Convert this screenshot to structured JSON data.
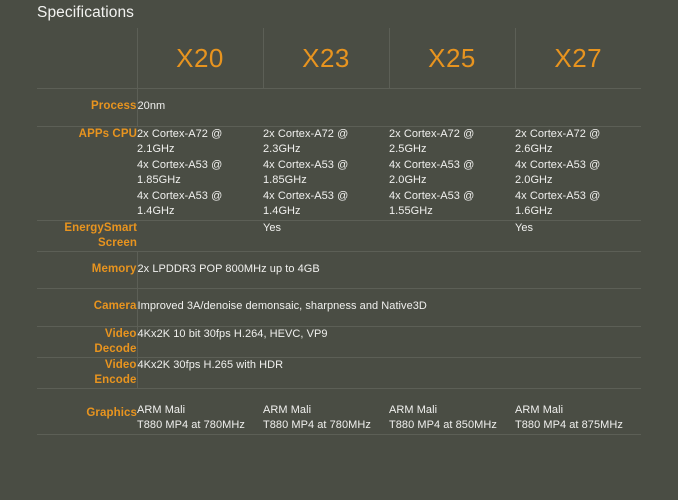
{
  "page": {
    "title": "Specifications",
    "background_color": "#4a4d44",
    "accent_color": "#e8941f",
    "text_color": "#f0f0ee",
    "grid_line_color": "#5c5f56"
  },
  "table": {
    "corner_label": "",
    "devices": [
      {
        "name": "X20"
      },
      {
        "name": "X23"
      },
      {
        "name": "X25"
      },
      {
        "name": "X27"
      }
    ],
    "rows": [
      {
        "id": "process",
        "label": "Process",
        "merged": true,
        "merged_value": [
          "20nm"
        ]
      },
      {
        "id": "apps-cpu",
        "label": "APPs CPU",
        "merged": false,
        "cells": [
          [
            "2x Cortex-A72 @",
            "2.1GHz",
            "4x Cortex-A53 @",
            "1.85GHz",
            "4x Cortex-A53 @",
            "1.4GHz"
          ],
          [
            "2x Cortex-A72 @",
            "2.3GHz",
            "4x Cortex-A53 @",
            "1.85GHz",
            "4x Cortex-A53 @",
            "1.4GHz"
          ],
          [
            "2x Cortex-A72 @",
            "2.5GHz",
            "4x Cortex-A53 @",
            "2.0GHz",
            "4x Cortex-A53 @",
            "1.55GHz"
          ],
          [
            "2x Cortex-A72 @",
            "2.6GHz",
            "4x Cortex-A53 @",
            "2.0GHz",
            "4x Cortex-A53 @",
            "1.6GHz"
          ]
        ]
      },
      {
        "id": "energysmart-screen",
        "label": "EnergySmart Screen",
        "label_lines": [
          "EnergySmart",
          "Screen"
        ],
        "merged": false,
        "cells": [
          [
            ""
          ],
          [
            "Yes"
          ],
          [
            ""
          ],
          [
            "Yes"
          ]
        ]
      },
      {
        "id": "memory",
        "label": "Memory",
        "merged": true,
        "merged_value": [
          "2x LPDDR3 POP 800MHz up to 4GB"
        ]
      },
      {
        "id": "camera",
        "label": "Camera",
        "merged": true,
        "merged_value": [
          "Improved 3A/denoise demonsaic, sharpness and Native3D"
        ]
      },
      {
        "id": "video-decode",
        "label": "Video Decode",
        "label_lines": [
          "Video",
          "Decode"
        ],
        "merged": true,
        "merged_value": [
          "4Kx2K 10 bit 30fps H.264, HEVC, VP9"
        ]
      },
      {
        "id": "video-encode",
        "label": "Video Encode",
        "label_lines": [
          "Video",
          "Encode"
        ],
        "merged": true,
        "merged_value": [
          "4Kx2K 30fps H.265 with HDR"
        ]
      },
      {
        "id": "graphics",
        "label": "Graphics",
        "merged": false,
        "cells": [
          [
            "ARM Mali",
            "T880 MP4 at 780MHz"
          ],
          [
            "ARM Mali",
            "T880 MP4 at 780MHz"
          ],
          [
            "ARM Mali",
            "T880 MP4 at 850MHz"
          ],
          [
            "ARM Mali",
            "T880 MP4 at 875MHz"
          ]
        ]
      }
    ]
  }
}
